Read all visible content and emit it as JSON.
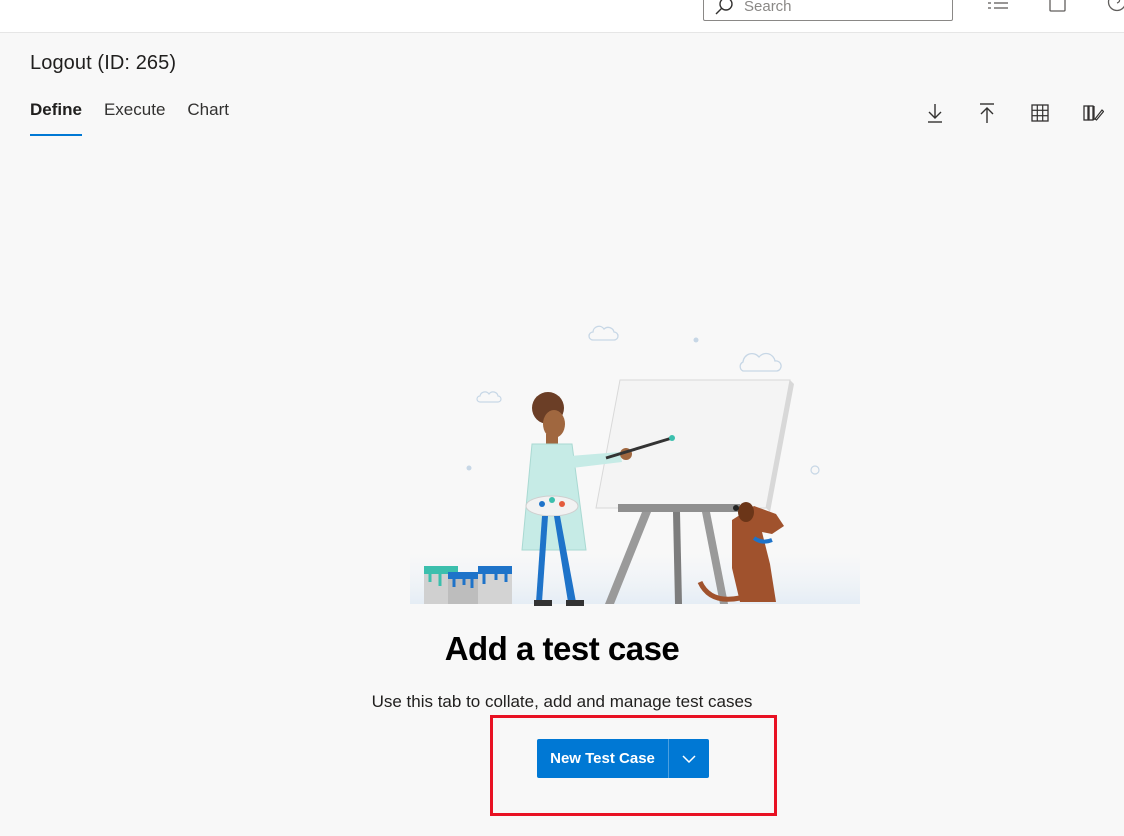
{
  "search": {
    "placeholder": "Search"
  },
  "page": {
    "title": "Logout (ID: 265)"
  },
  "tabs": [
    {
      "label": "Define",
      "active": true
    },
    {
      "label": "Execute",
      "active": false
    },
    {
      "label": "Chart",
      "active": false
    }
  ],
  "toolbar_icons": [
    "download-icon",
    "upload-icon",
    "grid-icon",
    "column-options-icon"
  ],
  "empty_state": {
    "title": "Add a test case",
    "subtitle": "Use this tab to collate, add and manage test cases",
    "new_button_label": "New Test Case"
  },
  "colors": {
    "accent": "#0078d4",
    "highlight": "#e81123",
    "background": "#f8f8f8"
  }
}
